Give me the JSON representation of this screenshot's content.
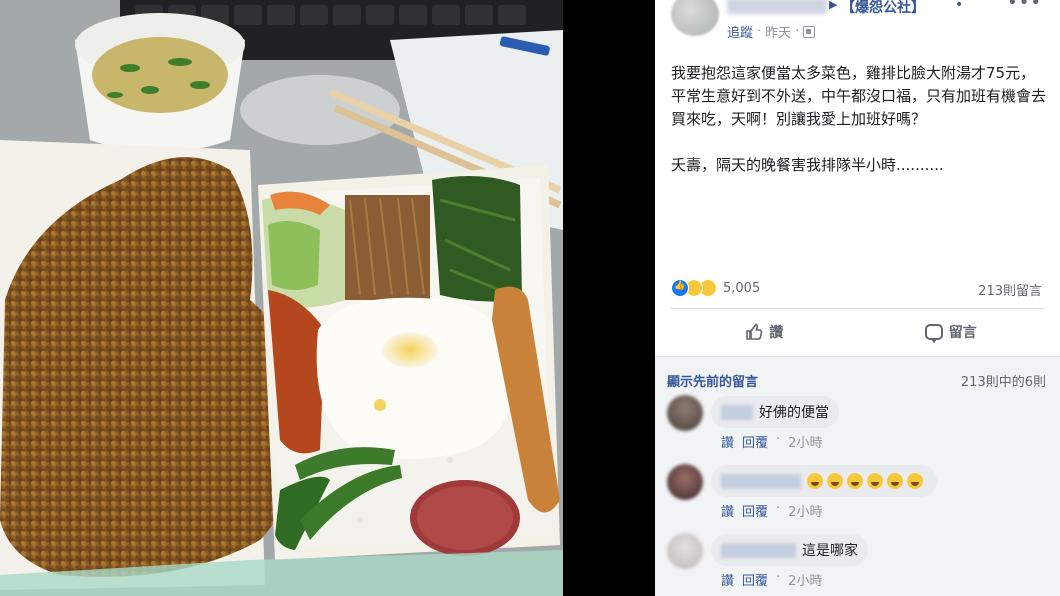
{
  "post": {
    "group_arrow": "▶",
    "group_name": "【爆怨公社】",
    "group_dot": "•",
    "more": "•••",
    "follow": "追蹤",
    "sep": "·",
    "time": "昨天",
    "sep2": "·",
    "body": "我要抱怨這家便當太多菜色，雞排比臉大附湯才75元，平常生意好到不外送，中午都沒口福，只有加班有機會去買來吃，天啊！別讓我愛上加班好嗎？\n\n夭壽，隔天的晚餐害我排隊半小時..........",
    "reaction_count": "5,005",
    "comment_count": "213則留言",
    "like_label": "讚",
    "comment_label": "留言"
  },
  "comments": {
    "show_previous": "顯示先前的留言",
    "range": "213則中的6則",
    "items": [
      {
        "text": "好佛的便當",
        "like": "讚",
        "reply": "回覆",
        "sep": "·",
        "time": "2小時"
      },
      {
        "text": "",
        "like": "讚",
        "reply": "回覆",
        "sep": "·",
        "time": "2小時"
      },
      {
        "text": "這是哪家",
        "like": "讚",
        "reply": "回覆",
        "sep": "·",
        "time": "2小時"
      }
    ]
  },
  "colors": {
    "link": "#365899",
    "secondary": "#606770",
    "comments_bg": "#f2f3f5"
  },
  "icons": [
    "more-icon",
    "globe-icon",
    "like-reaction-icon",
    "wow-reaction-icon",
    "haha-reaction-icon",
    "thumb-icon",
    "comment-bubble-icon",
    "laughing-emoji-icon"
  ]
}
